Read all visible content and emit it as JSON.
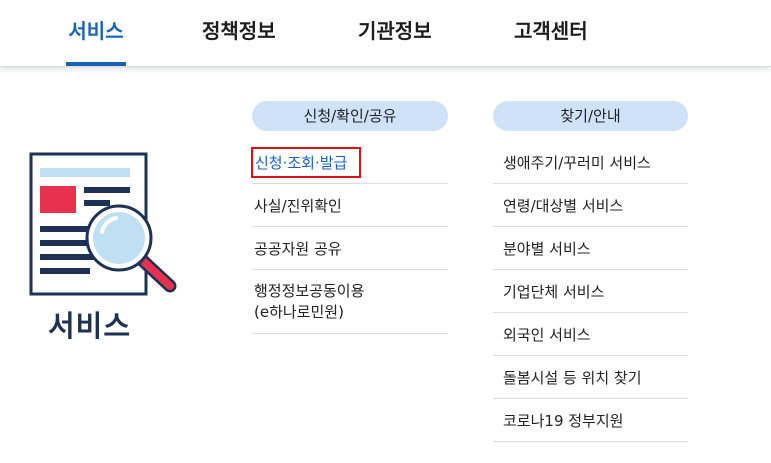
{
  "nav": {
    "tabs": [
      {
        "label": "서비스",
        "active": true
      },
      {
        "label": "정책정보",
        "active": false
      },
      {
        "label": "기관정보",
        "active": false
      },
      {
        "label": "고객센터",
        "active": false
      }
    ],
    "accent_color": "#1a63b8"
  },
  "section": {
    "title": "서비스",
    "icon": "document-magnifier-icon"
  },
  "columns": [
    {
      "header": "신청/확인/공유",
      "items": [
        {
          "label": "신청·조회·발급",
          "highlighted": true
        },
        {
          "label": "사실/진위확인"
        },
        {
          "label": "공공자원 공유"
        },
        {
          "label_line1": "행정정보공동이용",
          "label_line2": "(e하나로민원)"
        }
      ]
    },
    {
      "header": "찾기/안내",
      "items": [
        {
          "label": "생애주기/꾸러미 서비스"
        },
        {
          "label": "연령/대상별 서비스"
        },
        {
          "label": "분야별 서비스"
        },
        {
          "label": "기업단체 서비스"
        },
        {
          "label": "외국인 서비스"
        },
        {
          "label": "돌봄시설 등 위치 찾기"
        },
        {
          "label": "코로나19 정부지원"
        }
      ]
    }
  ],
  "colors": {
    "header_pill": "#cfe2f8",
    "highlight_border": "#d3141b",
    "title_navy": "#1f3154"
  }
}
